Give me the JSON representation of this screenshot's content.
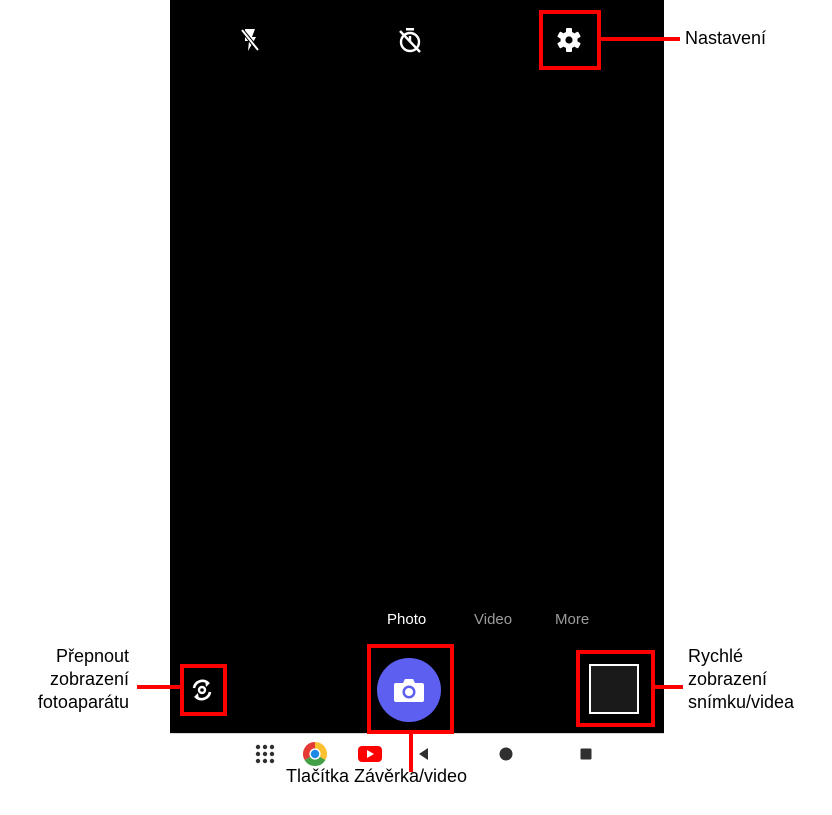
{
  "camera": {
    "top_icons": [
      "flash-off-icon",
      "timer-off-icon",
      "gear-icon"
    ],
    "modes": [
      {
        "label": "Photo",
        "active": true
      },
      {
        "label": "Video",
        "active": false
      },
      {
        "label": "More",
        "active": false
      }
    ],
    "shutter_color": "#5c5ff0",
    "switch_camera_icon": "camera-switch-icon",
    "thumbnail_color": "#1a1a1a"
  },
  "navbar": {
    "items": [
      "apps-grid-icon",
      "chrome-icon",
      "youtube-icon",
      "back-icon",
      "home-icon",
      "recents-icon"
    ]
  },
  "callouts": {
    "settings": "Nastavení",
    "switch_camera": "Přepnout\nzobrazení\nfotoaparátu",
    "shutter": "Tlačítka Závěrka/video",
    "quick_view": "Rychlé\nzobrazení\nsnímku/videa"
  },
  "colors": {
    "highlight": "#ff0000",
    "screen": "#000000"
  }
}
